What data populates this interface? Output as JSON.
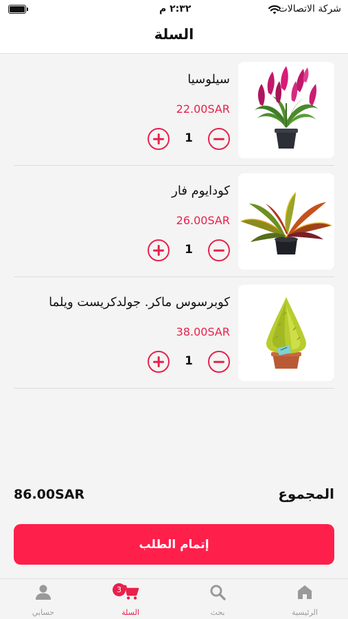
{
  "status_bar": {
    "carrier": "شركة الاتصالات",
    "time": "٢:٣٢ م",
    "wifi_icon": "wifi-icon",
    "battery_icon": "battery-icon",
    "battery_level": 1.0
  },
  "header": {
    "title": "السلة"
  },
  "cart": {
    "items": [
      {
        "name": "سيلوسيا",
        "price": "22.00SAR",
        "quantity": "1",
        "image": "pink-flower-plant"
      },
      {
        "name": "كودايوم فار",
        "price": "26.00SAR",
        "quantity": "1",
        "image": "croton-plant"
      },
      {
        "name": "كوبرسوس ماكر. جولدكريست ويلما",
        "price": "38.00SAR",
        "quantity": "1",
        "image": "cypress-plant"
      }
    ]
  },
  "total": {
    "label": "المجموع",
    "value": "86.00SAR"
  },
  "checkout": {
    "label": "إتمام الطلب"
  },
  "nav": {
    "items": [
      {
        "label": "الرئيسية",
        "icon": "home-icon"
      },
      {
        "label": "بحث",
        "icon": "search-icon"
      },
      {
        "label": "السلة",
        "icon": "cart-icon",
        "badge": "3"
      },
      {
        "label": "حسابي",
        "icon": "user-icon"
      }
    ]
  },
  "colors": {
    "accent": "#e8214b",
    "checkout_bg": "#ff1f4b",
    "nav_inactive": "#999999"
  }
}
